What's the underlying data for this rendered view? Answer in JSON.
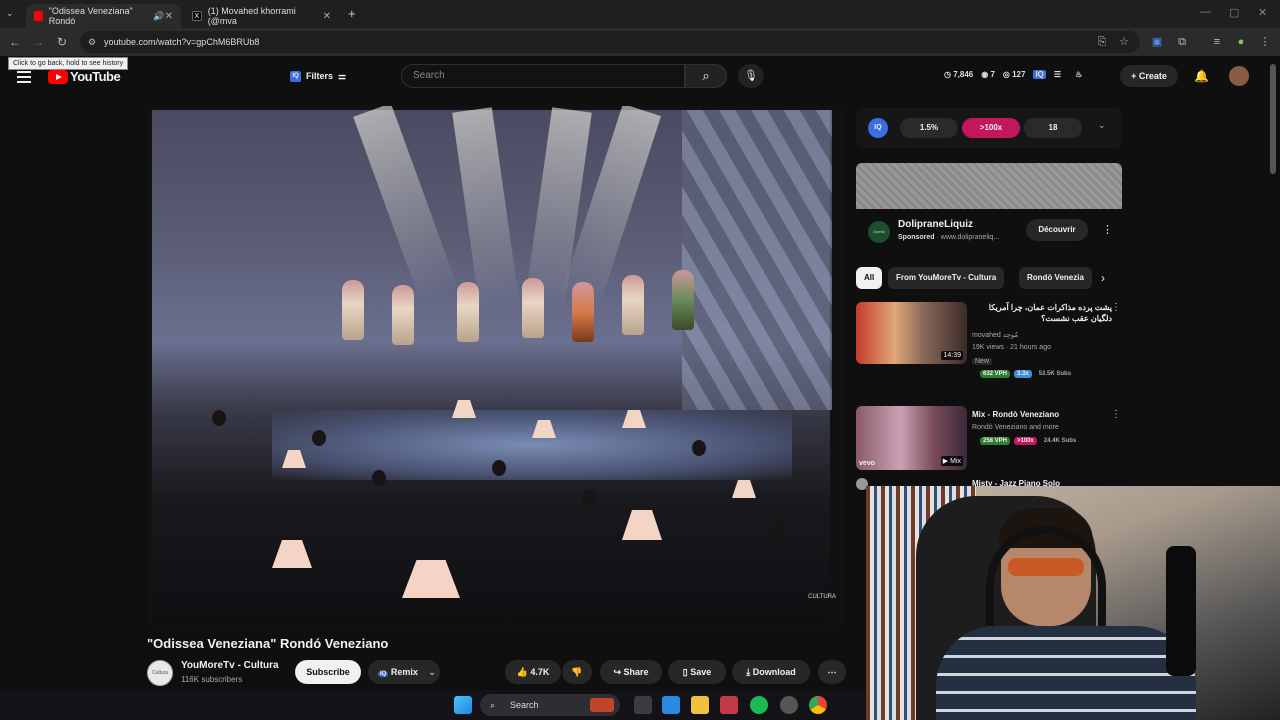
{
  "browser": {
    "tabs": [
      {
        "title": "\"Odissea Veneziana\" Rondó",
        "active": true
      },
      {
        "title": "(1) Movahed khorrami (@mva",
        "active": false
      }
    ],
    "url": "youtube.com/watch?v=gpChM6BRUb8",
    "tooltip": "Click to go back, hold to see history"
  },
  "header": {
    "logo": "YouTube",
    "filters_label": "Filters",
    "search_placeholder": "Search",
    "stats": {
      "views": "7,846",
      "eyes": "7",
      "watch": "127"
    },
    "create_label": "Create"
  },
  "video": {
    "watermark": "CULTURA",
    "title": "\"Odissea Veneziana\" Rondó Veneziano",
    "channel": "YouMoreTv - Cultura",
    "subscribers": "116K subscribers",
    "avatar_text": "Cultura",
    "subscribe_label": "Subscribe",
    "remix_label": "Remix",
    "likes": "4.7K",
    "share_label": "Share",
    "save_label": "Save",
    "download_label": "Download"
  },
  "vidiq": {
    "logo": "IQ",
    "chip1": "1.5%",
    "chip2": ">100x",
    "chip3": "18"
  },
  "ad": {
    "title": "DolipraneLiquiz",
    "sponsored": "Sponsored",
    "domain": "· www.dolipraneliq...",
    "logo_text": "Opella",
    "cta": "Découvrir"
  },
  "chips": [
    "All",
    "From YouMoreTv - Cultura",
    "Rondò Venezia"
  ],
  "recommendations": [
    {
      "title": "پشت پرده مذاکرات عمان، چرا آمریکا دلگیان عقب نشست؟",
      "channel": "movahed مُوحِد",
      "meta": "19K views · 21 hours ago",
      "badge_new": "New",
      "duration": "14:39",
      "vph": "632 VPH",
      "multiplier": "3.3x",
      "subs": "53.5K Subs"
    },
    {
      "title": "Mix - Rondò Veneziano",
      "channel": "Rondò Veneziano and more",
      "vph": "258 VPH",
      "multiplier": ">100x",
      "subs": "24.4K Subs",
      "duration": "Mix",
      "thumb_label": "vevo"
    },
    {
      "title": "Misty - Jazz Piano Solo"
    }
  ],
  "taskbar": {
    "search": "Search"
  },
  "colors": {
    "yt_red": "#ff0000",
    "vidiq_blue": "#3b6fe0",
    "vidiq_pink": "#c2185b",
    "badge_green": "#2e7d32"
  }
}
